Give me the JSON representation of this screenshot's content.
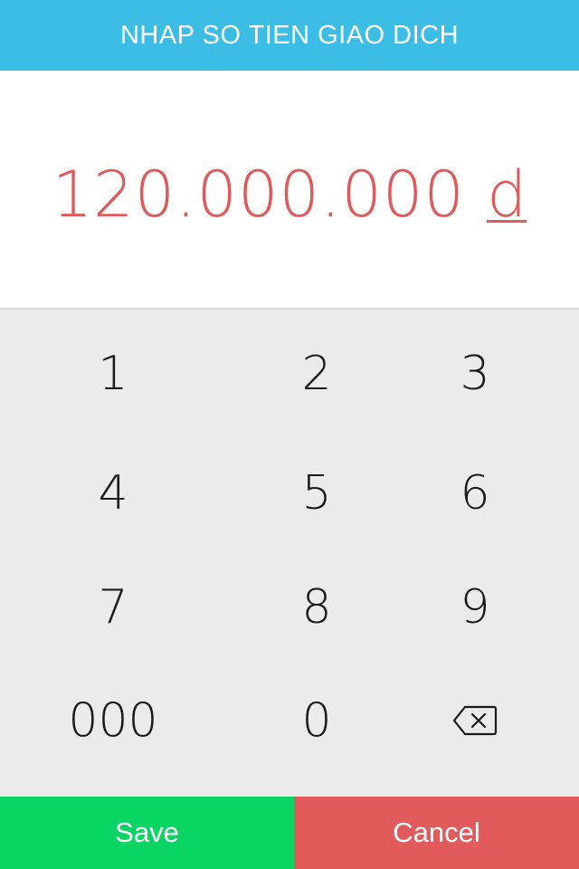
{
  "header": {
    "title": "NHAP SO TIEN GIAO DICH"
  },
  "amount": {
    "value": "120.000.000",
    "currency": "d",
    "color": "#e05a5b"
  },
  "keypad": {
    "keys": [
      "1",
      "2",
      "3",
      "4",
      "5",
      "6",
      "7",
      "8",
      "9",
      "000",
      "0"
    ],
    "backspace_icon": "backspace-icon"
  },
  "actions": {
    "save_label": "Save",
    "cancel_label": "Cancel",
    "save_color": "#0ad463",
    "cancel_color": "#e15b5c"
  },
  "colors": {
    "header": "#3bbde6",
    "keypad_background": "#ebebeb"
  }
}
